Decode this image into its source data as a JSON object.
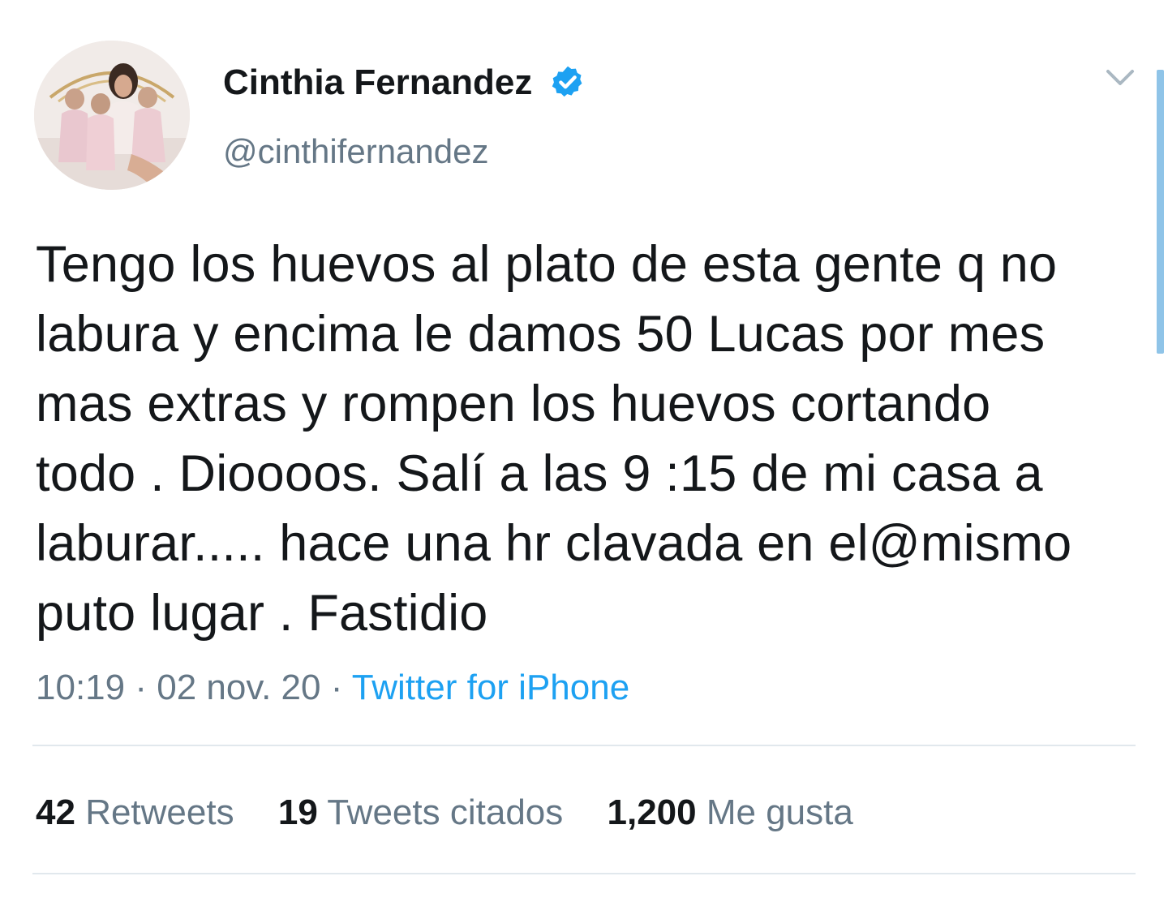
{
  "user": {
    "display_name": "Cinthia Fernandez",
    "handle": "@cinthifernandez",
    "verified": true
  },
  "icons": {
    "verified": "verified-badge-icon",
    "more": "chevron-down-icon"
  },
  "tweet": {
    "lines": [
      "Tengo los huevos al plato de esta gente q no",
      "labura y encima le damos 50 Lucas por mes",
      "mas extras y rompen los huevos cortando",
      "todo . Dioooos. Salí a las 9 :15 de mi casa a",
      "laburar..... hace una hr clavada en el@mismo",
      "puto lugar . Fastidio"
    ],
    "time": "10:19",
    "date": "02 nov. 20",
    "separator": "·",
    "source": "Twitter for iPhone"
  },
  "stats": {
    "retweets": {
      "count": "42",
      "label": "Retweets"
    },
    "quotes": {
      "count": "19",
      "label": "Tweets citados"
    },
    "likes": {
      "count": "1,200",
      "label": "Me gusta"
    }
  },
  "colors": {
    "text": "#14171a",
    "secondary": "#657786",
    "accent": "#1da1f2",
    "divider": "#e1e8ed"
  }
}
